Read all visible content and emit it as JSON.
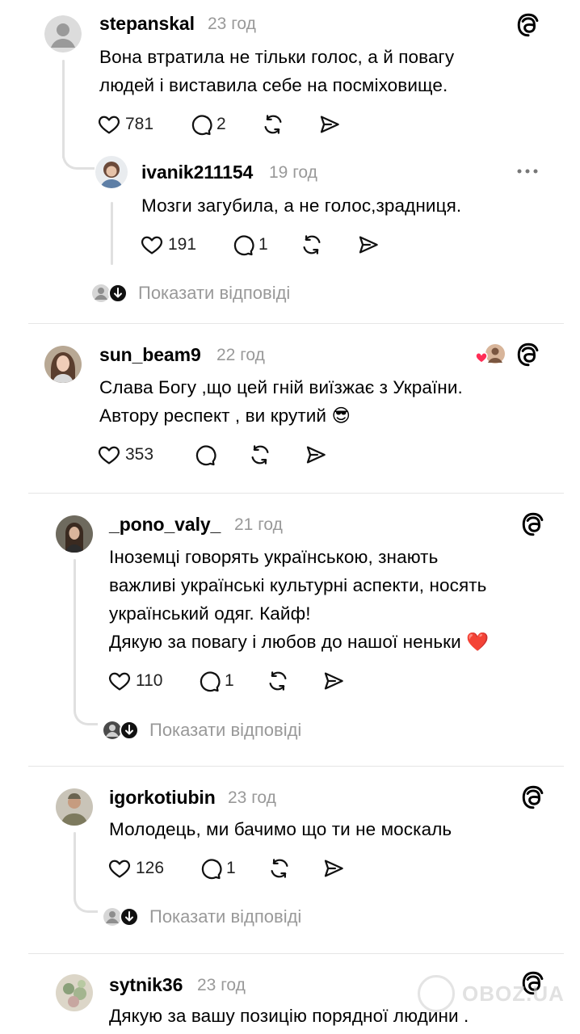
{
  "comments": [
    {
      "username": "stepanskal",
      "time": "23 год",
      "text": "Вона втратила не тільки голос, а й повагу\nлюдей і виставила себе на посміховище.",
      "likes": "781",
      "replies": "2"
    },
    {
      "username": "ivanik211154",
      "time": "19 год",
      "text": "Мозги загубила, а не голос,зрадниця.",
      "likes": "191",
      "replies": "1"
    },
    {
      "username": "sun_beam9",
      "time": "22 год",
      "text": "Слава Богу ,що цей гній виїзжає з України.\nАвтору респект , ви крутий 😎",
      "likes": "353",
      "replies": ""
    },
    {
      "username": "_pono_valy_",
      "time": "21 год",
      "text": "Іноземці говорять українською, знають\nважливі українські культурні аспекти, носять\nукраїнський одяг. Кайф!\nДякую за повагу і любов до нашої неньки ❤️",
      "likes": "110",
      "replies": "1"
    },
    {
      "username": "igorkotiubin",
      "time": "23 год",
      "text": "Молодець, ми бачимо що ти не москаль",
      "likes": "126",
      "replies": "1"
    },
    {
      "username": "sytnik36",
      "time": "23 год",
      "text": "Дякую за вашу позицію порядної людини .",
      "likes": "",
      "replies": ""
    }
  ],
  "show_replies_label": "Показати відповіді",
  "watermark": "OBOZ.UA",
  "icons": {
    "like": "heart-icon",
    "reply": "comment-bubble-icon",
    "repost": "repost-icon",
    "share": "send-icon",
    "app": "threads-logo-icon",
    "more": "more-dots-icon"
  }
}
